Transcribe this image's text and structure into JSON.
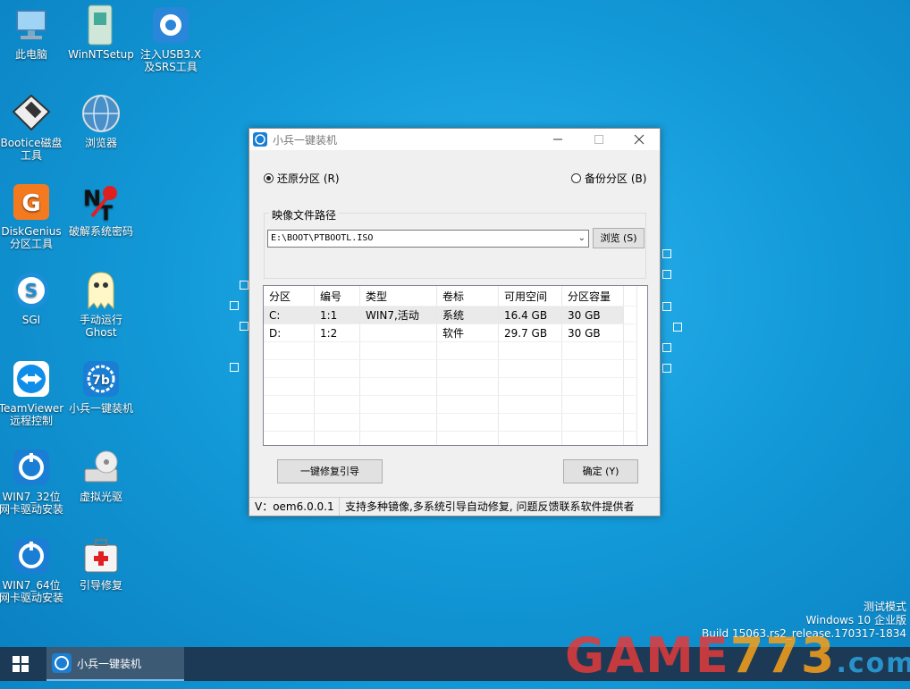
{
  "desktop": {
    "icons": [
      {
        "label": "此电脑"
      },
      {
        "label": "WinNTSetup"
      },
      {
        "label": "注入USB3.X\n及SRS工具"
      },
      {
        "label": "Bootice磁盘\n工具"
      },
      {
        "label": "浏览器"
      },
      {
        "label": "DiskGenius\n分区工具"
      },
      {
        "label": "破解系统密码"
      },
      {
        "label": "SGI"
      },
      {
        "label": "手动运行\nGhost"
      },
      {
        "label": "TeamViewer\n远程控制"
      },
      {
        "label": "小兵一键装机"
      },
      {
        "label": "WIN7_32位\n网卡驱动安装"
      },
      {
        "label": "虚拟光驱"
      },
      {
        "label": "WIN7_64位\n网卡驱动安装"
      },
      {
        "label": "引导修复"
      }
    ]
  },
  "window": {
    "title": "小兵一键装机",
    "radio_restore": "还原分区 (R)",
    "radio_backup": "备份分区 (B)",
    "image_group_label": "映像文件路径",
    "image_path": "E:\\BOOT\\PTBOOTL.ISO",
    "browse_label": "浏览 (S)",
    "columns": [
      "分区",
      "编号",
      "类型",
      "卷标",
      "可用空间",
      "分区容量"
    ],
    "rows": [
      [
        "C:",
        "1:1",
        "WIN7,活动",
        "系统",
        "16.4 GB",
        "30 GB"
      ],
      [
        "D:",
        "1:2",
        "",
        "软件",
        "29.7 GB",
        "30 GB"
      ]
    ],
    "repair_button": "一键修复引导",
    "ok_button": "确定 (Y)",
    "status_version": "V：oem6.0.0.1",
    "status_message": "支持多种镜像,多系统引导自动修复, 问题反馈联系软件提供者"
  },
  "os_info": {
    "line1": "测试模式",
    "line2": "Windows 10 企业版",
    "line3": "Build 15063.rs2_release.170317-1834"
  },
  "taskbar": {
    "app_label": "小兵一键装机"
  },
  "watermark": {
    "part1": "GAME",
    "part2": "773",
    "part3": ".com"
  }
}
